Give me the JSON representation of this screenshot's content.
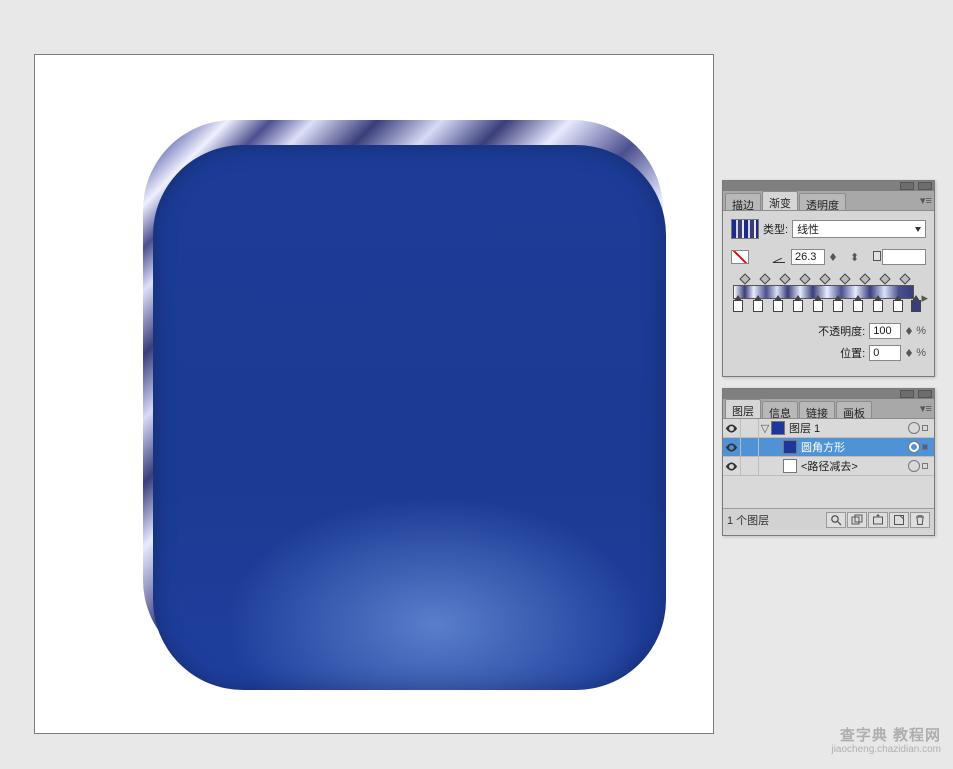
{
  "gradient_panel": {
    "tabs": {
      "stroke": "描边",
      "gradient": "渐变",
      "transparency": "透明度"
    },
    "type_label": "类型:",
    "type_value": "线性",
    "angle_value": "26.3",
    "opacity_label": "不透明度:",
    "opacity_value": "100",
    "location_label": "位置:",
    "location_value": "0",
    "percent": "%"
  },
  "layers_panel": {
    "tabs": {
      "layers": "图层",
      "info": "信息",
      "links": "链接",
      "artboards": "画板"
    },
    "layer1_name": "图层 1",
    "sublayer1_name": "圆角方形",
    "sublayer2_name": "<路径减去>",
    "footer_count": "1 个图层"
  },
  "watermark": {
    "main": "查字典 教程网",
    "sub": "jiaocheng.chazidian.com"
  }
}
